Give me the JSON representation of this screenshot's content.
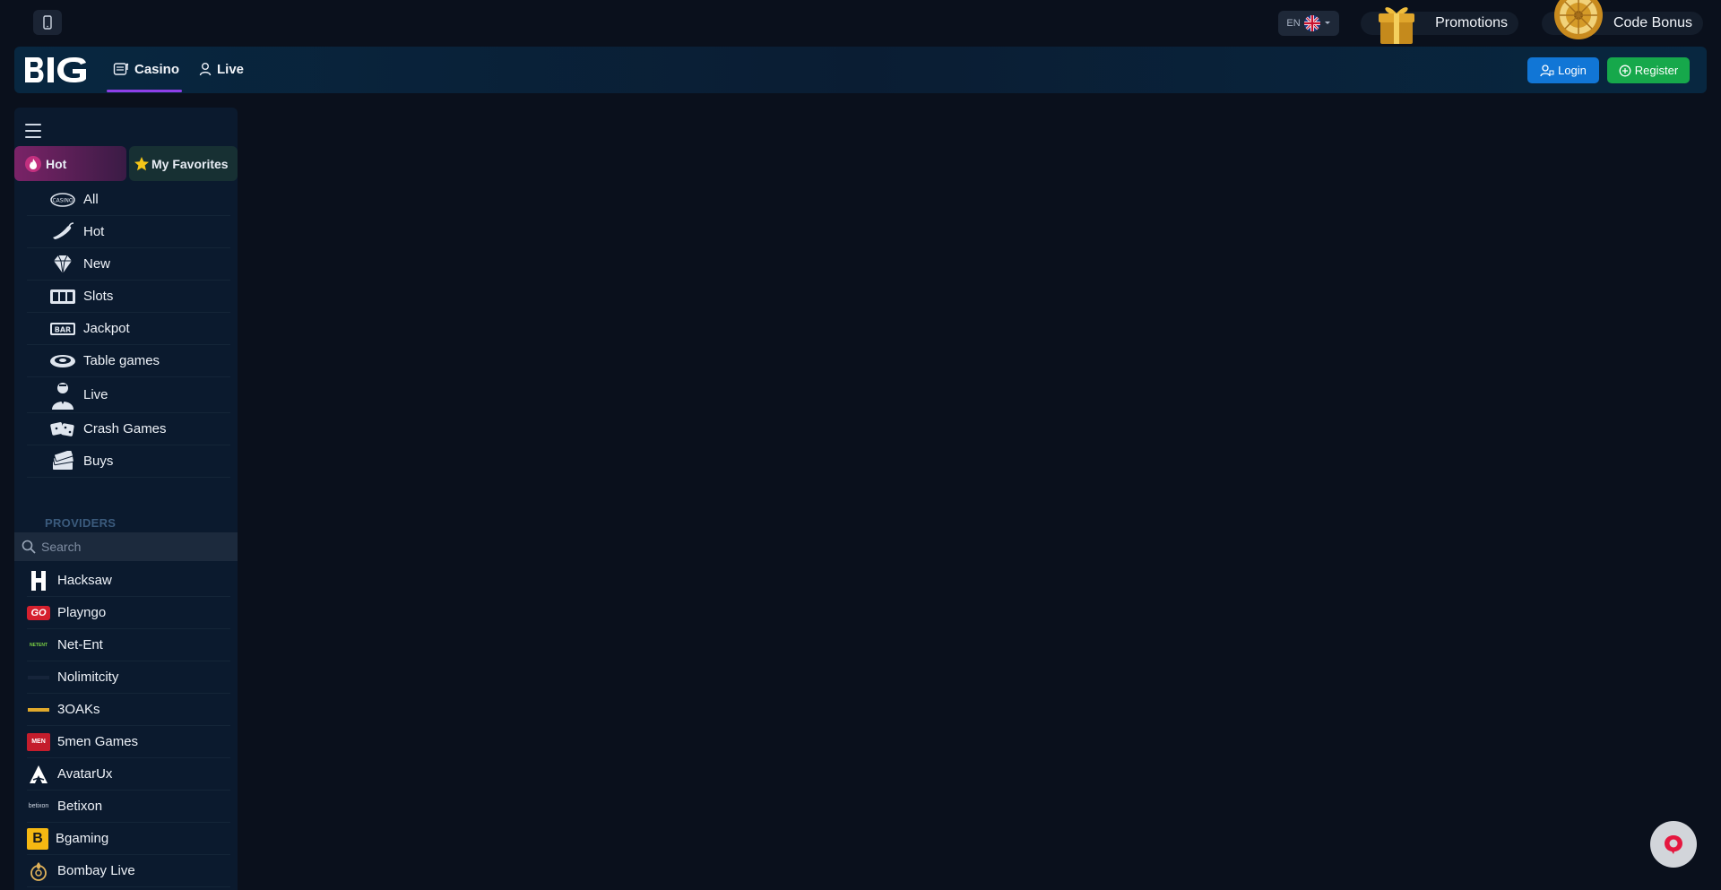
{
  "topbar": {
    "language": "EN",
    "promotions_label": "Promotions",
    "code_bonus_label": "Code Bonus"
  },
  "nav": {
    "tabs": [
      {
        "label": "Casino",
        "active": true
      },
      {
        "label": "Live",
        "active": false
      }
    ],
    "login_label": "Login",
    "register_label": "Register",
    "accent": "#8e3fe8",
    "login_color": "#1176d6",
    "register_color": "#16a84b"
  },
  "sidebar": {
    "tabs": {
      "hot": "Hot",
      "favorites": "My Favorites"
    },
    "categories": [
      {
        "label": "All",
        "icon": "casino-chip-icon"
      },
      {
        "label": "Hot",
        "icon": "chili-icon"
      },
      {
        "label": "New",
        "icon": "diamond-icon"
      },
      {
        "label": "Slots",
        "icon": "slot-machine-icon"
      },
      {
        "label": "Jackpot",
        "icon": "bar-icon"
      },
      {
        "label": "Table games",
        "icon": "roulette-table-icon"
      },
      {
        "label": "Live",
        "icon": "dealer-icon"
      },
      {
        "label": "Crash Games",
        "icon": "dice-icon"
      },
      {
        "label": "Buys",
        "icon": "cash-stack-icon"
      }
    ],
    "providers_title": "PROVIDERS",
    "search_placeholder": "Search",
    "providers": [
      {
        "label": "Hacksaw",
        "icon": "hacksaw-logo"
      },
      {
        "label": "Playngo",
        "icon": "playngo-logo",
        "logo_text": "GO"
      },
      {
        "label": "Net-Ent",
        "icon": "netent-logo",
        "logo_text": "NETENT"
      },
      {
        "label": "Nolimitcity",
        "icon": "nolimitcity-logo"
      },
      {
        "label": "3OAKs",
        "icon": "3oaks-logo"
      },
      {
        "label": "5men Games",
        "icon": "5men-logo",
        "logo_text": "MEN"
      },
      {
        "label": "AvatarUx",
        "icon": "avatarux-logo"
      },
      {
        "label": "Betixon",
        "icon": "betixon-logo",
        "logo_text": "betixon"
      },
      {
        "label": "Bgaming",
        "icon": "bgaming-logo",
        "logo_text": "B"
      },
      {
        "label": "Bombay Live",
        "icon": "bombay-live-logo"
      }
    ]
  }
}
